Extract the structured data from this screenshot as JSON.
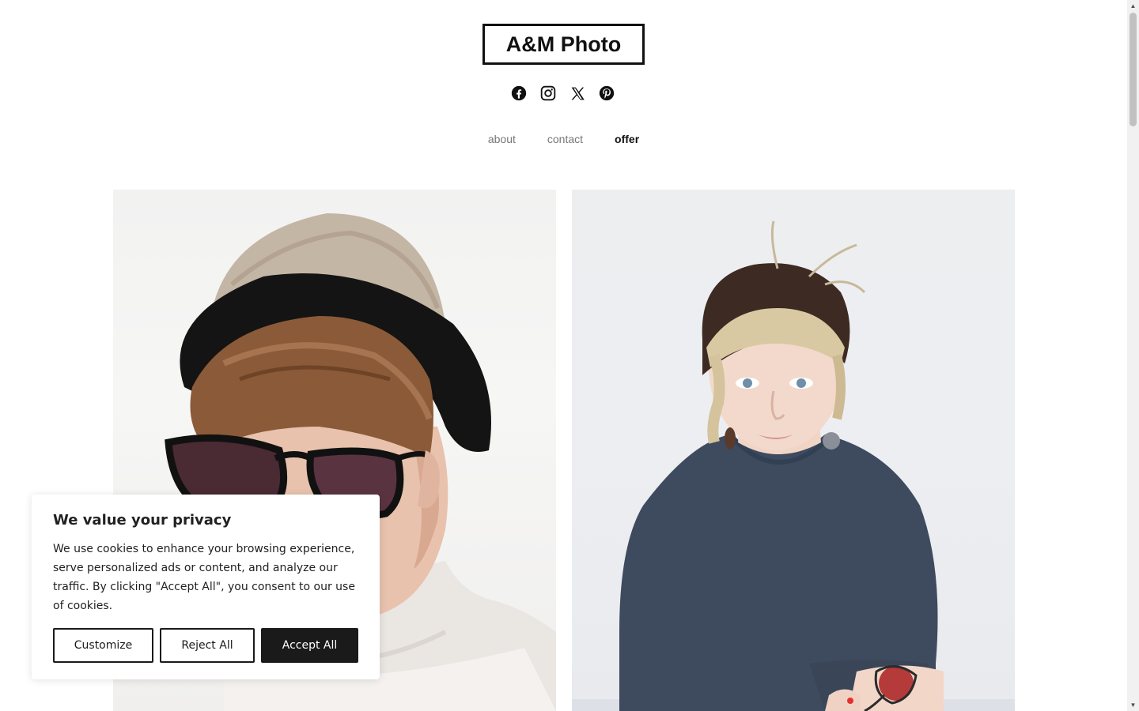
{
  "site": {
    "logo": "A&M Photo"
  },
  "social": [
    {
      "name": "facebook-icon"
    },
    {
      "name": "instagram-icon"
    },
    {
      "name": "x-icon"
    },
    {
      "name": "pinterest-icon"
    }
  ],
  "nav": {
    "items": [
      {
        "label": "about",
        "active": false
      },
      {
        "label": "contact",
        "active": false
      },
      {
        "label": "offer",
        "active": true
      }
    ]
  },
  "cookie": {
    "title": "We value your privacy",
    "body": "We use cookies to enhance your browsing experience, serve personalized ads or content, and analyze our traffic. By clicking \"Accept All\", you consent to our use of cookies.",
    "customize": "Customize",
    "reject": "Reject All",
    "accept": "Accept All"
  },
  "colors": {
    "text": "#111111",
    "nav_inactive": "#777777",
    "accept_bg": "#1a1a1a"
  }
}
